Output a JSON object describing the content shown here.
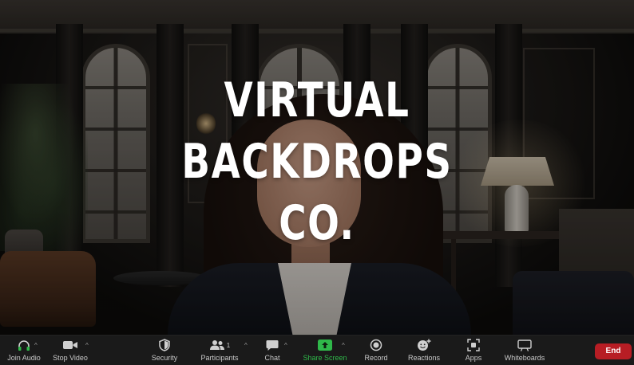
{
  "overlay": {
    "title_lines": [
      "VIRTUAL",
      "BACKDROPS",
      "CO."
    ]
  },
  "toolbar": {
    "join_audio": {
      "label": "Join Audio",
      "icon": "headphones-icon"
    },
    "stop_video": {
      "label": "Stop Video",
      "icon": "video-camera-icon"
    },
    "security": {
      "label": "Security",
      "icon": "shield-icon"
    },
    "participants": {
      "label": "Participants",
      "icon": "people-icon",
      "count": "1"
    },
    "chat": {
      "label": "Chat",
      "icon": "chat-bubble-icon"
    },
    "share_screen": {
      "label": "Share Screen",
      "icon": "share-screen-icon"
    },
    "record": {
      "label": "Record",
      "icon": "record-icon"
    },
    "reactions": {
      "label": "Reactions",
      "icon": "smiley-plus-icon"
    },
    "apps": {
      "label": "Apps",
      "icon": "apps-grid-icon"
    },
    "whiteboards": {
      "label": "Whiteboards",
      "icon": "whiteboard-icon"
    },
    "end": {
      "label": "End"
    },
    "caret": "^"
  },
  "colors": {
    "toolbar_bg": "#1a1a1a",
    "share_green": "#2fb84a",
    "end_red": "#b71d24"
  }
}
